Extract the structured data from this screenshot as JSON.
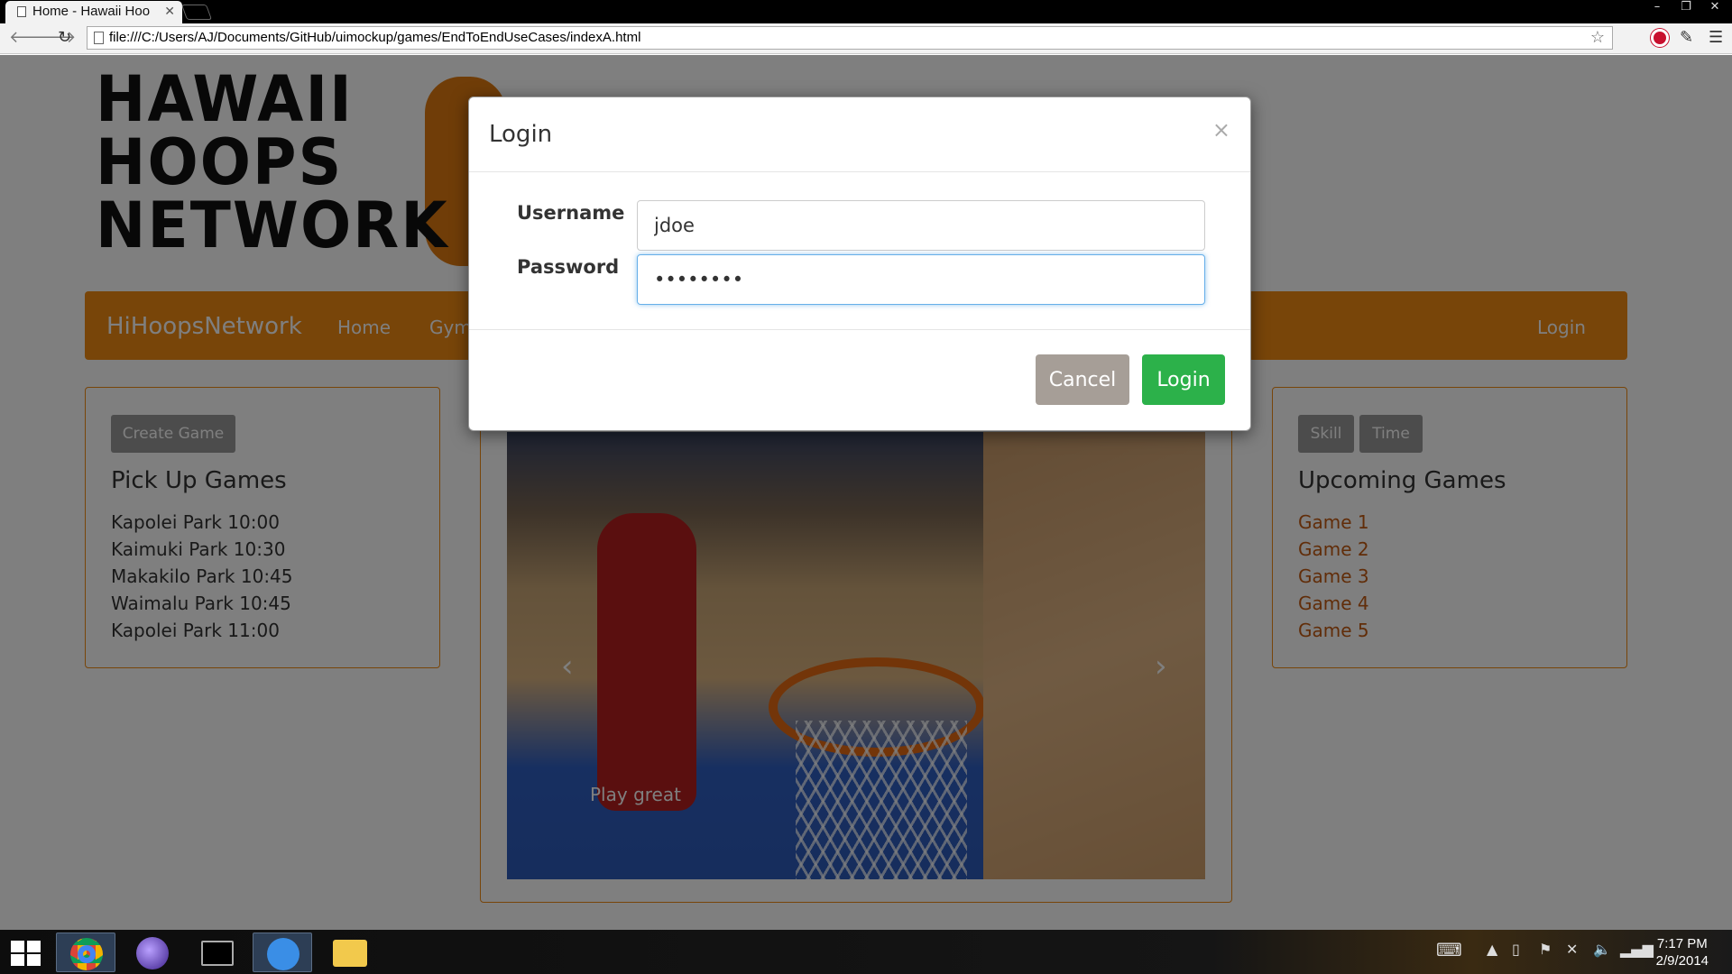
{
  "browser": {
    "tab_title": "Home - Hawaii Hoo",
    "url": "file:///C:/Users/AJ/Documents/GitHub/uimockup/games/EndToEndUseCases/indexA.html"
  },
  "page": {
    "logo_lines": [
      "HAWAII",
      "HOOPS",
      "NETWORK"
    ],
    "navbar": {
      "brand": "HiHoopsNetwork",
      "links": [
        "Home",
        "Gym"
      ],
      "login": "Login"
    },
    "left_panel": {
      "button": "Create Game",
      "title": "Pick Up Games",
      "games": [
        "Kapolei Park 10:00",
        "Kaimuki Park 10:30",
        "Makakilo Park 10:45",
        "Waimalu Park 10:45",
        "Kapolei Park 11:00"
      ]
    },
    "carousel": {
      "caption": "Play great"
    },
    "right_panel": {
      "filters": [
        "Skill",
        "Time"
      ],
      "title": "Upcoming Games",
      "games": [
        "Game 1",
        "Game 2",
        "Game 3",
        "Game 4",
        "Game 5"
      ]
    }
  },
  "modal": {
    "title": "Login",
    "close": "×",
    "username_label": "Username",
    "username_value": "jdoe",
    "password_label": "Password",
    "password_value": "••••••••",
    "cancel": "Cancel",
    "login": "Login"
  },
  "taskbar": {
    "time": "7:17 PM",
    "date": "2/9/2014"
  },
  "colors": {
    "accent": "#f08a12",
    "success": "#2cb14a",
    "link": "#c35a12"
  }
}
